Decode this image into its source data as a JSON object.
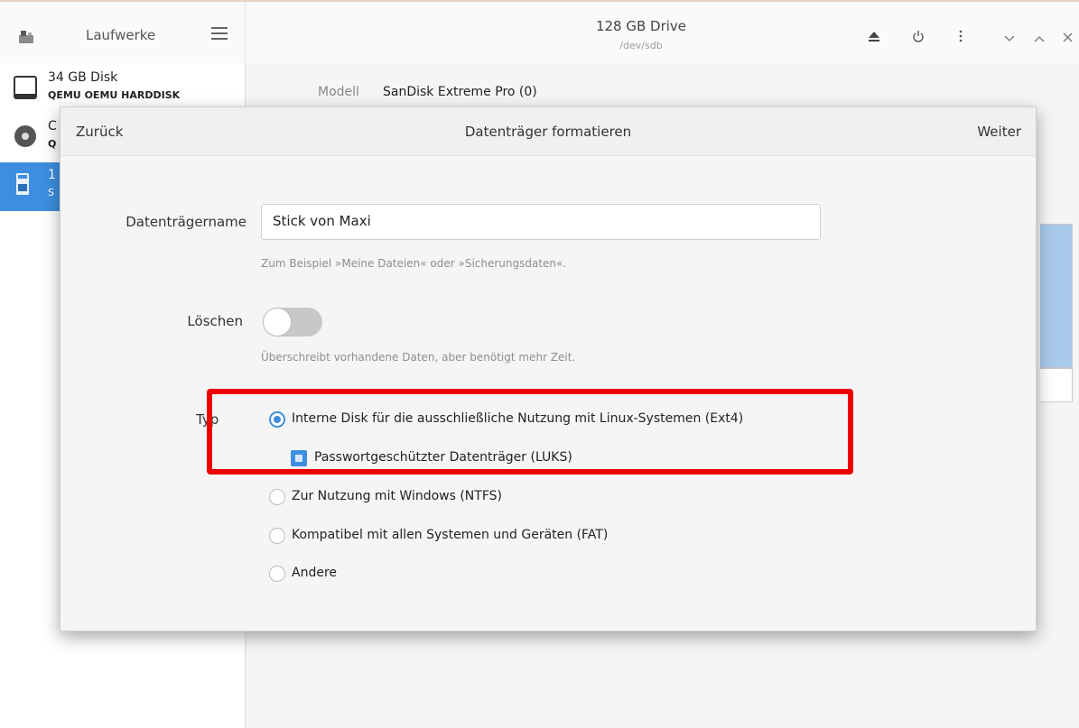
{
  "header": {
    "app_title": "Laufwerke",
    "drive_title": "128 GB Drive",
    "drive_device": "/dev/sdb",
    "icons": [
      "drive-icon",
      "menu-icon",
      "eject-icon",
      "power-icon",
      "more-icon",
      "minimize-icon",
      "maximize-icon",
      "close-icon"
    ]
  },
  "sidebar": {
    "items": [
      {
        "title": "34 GB Disk",
        "subtitle": "QEMU OEMU HARDDISK",
        "icon": "harddisk-icon"
      },
      {
        "title": "C",
        "subtitle": "Q",
        "icon": "optical-disc-icon"
      },
      {
        "title": "1",
        "subtitle": "S",
        "icon": "usb-drive-icon",
        "selected": true
      }
    ]
  },
  "content": {
    "model_label": "Modell",
    "model_value": "SanDisk Extreme Pro (0)"
  },
  "dialog": {
    "back_label": "Zurück",
    "title": "Datenträger formatieren",
    "next_label": "Weiter",
    "name_label": "Datenträgername",
    "name_value": "Stick von Maxi",
    "name_hint": "Zum Beispiel »Meine Dateien« oder »Sicherungsdaten«.",
    "erase_label": "Löschen",
    "erase_enabled": false,
    "erase_hint": "Überschreibt vorhandene Daten, aber benötigt mehr Zeit.",
    "type_label": "Typ",
    "options": [
      {
        "label": "Interne Disk für die ausschließliche Nutzung mit Linux-Systemen (Ext4)",
        "checked": true
      },
      {
        "label": "Passwortgeschützter Datenträger (LUKS)",
        "checked": true,
        "kind": "checkbox"
      },
      {
        "label": "Zur Nutzung mit Windows (NTFS)",
        "checked": false
      },
      {
        "label": "Kompatibel mit allen Systemen und Geräten (FAT)",
        "checked": false
      },
      {
        "label": "Andere",
        "checked": false
      }
    ]
  },
  "colors": {
    "accent": "#3d8ee0",
    "highlight": "#ec0000"
  }
}
